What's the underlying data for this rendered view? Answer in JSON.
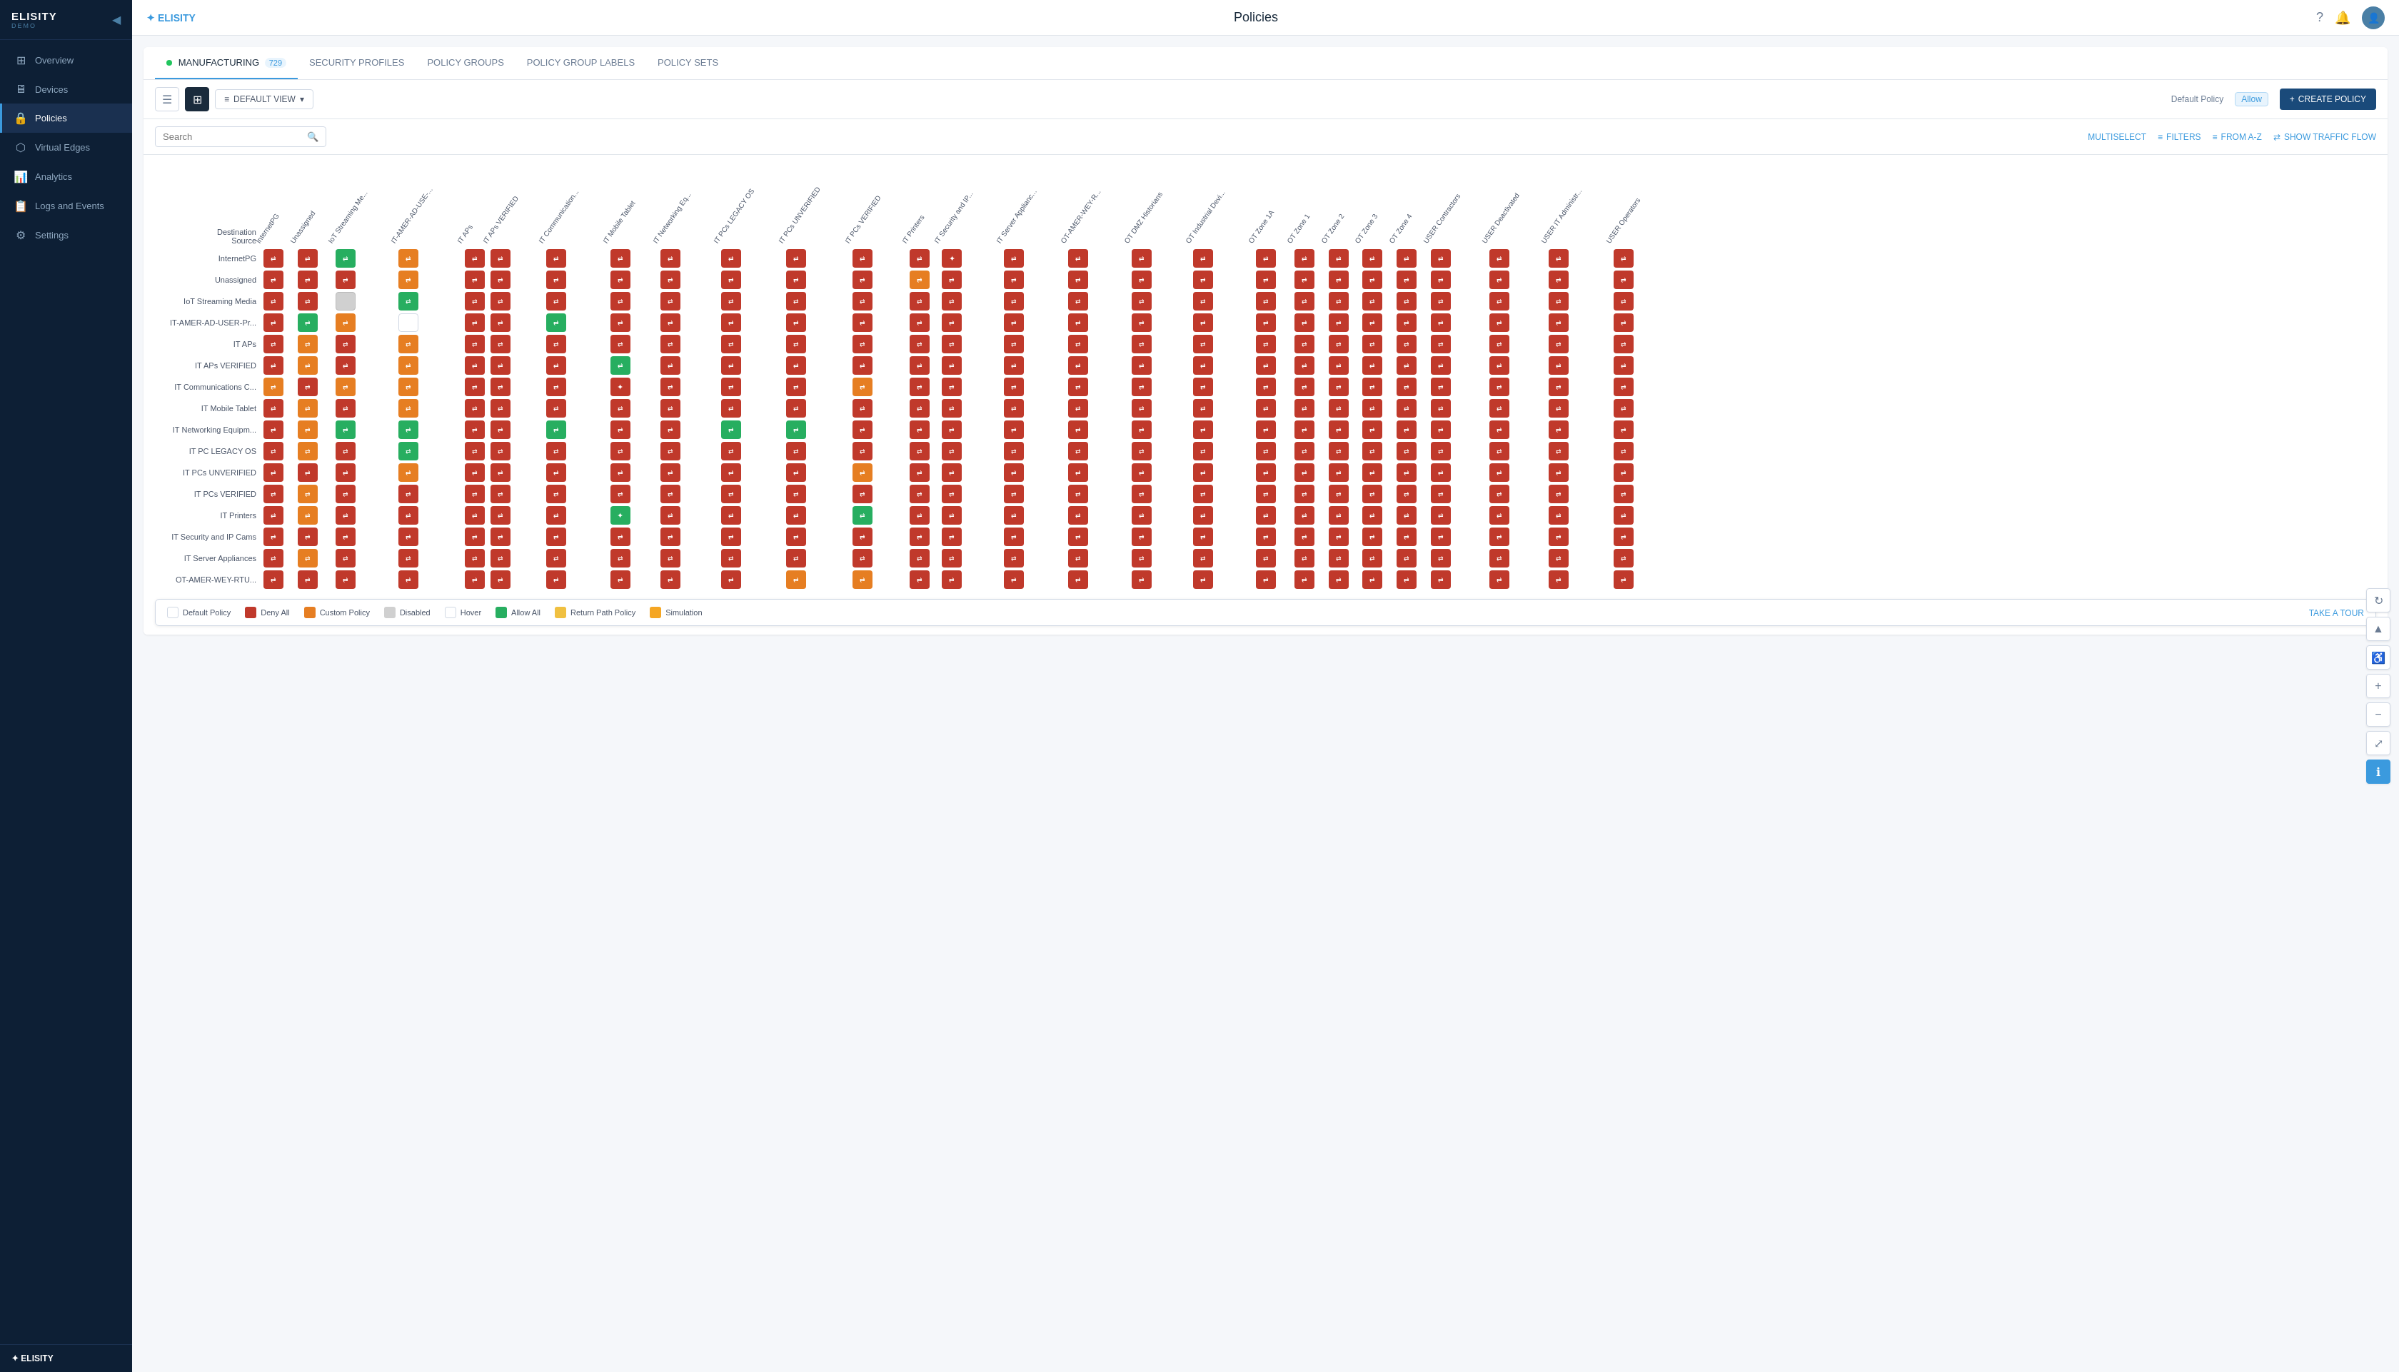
{
  "sidebar": {
    "logo": "ELISITY",
    "logo_sub": "DEMO",
    "collapse_icon": "◀",
    "items": [
      {
        "id": "overview",
        "label": "Overview",
        "icon": "⊞",
        "active": false
      },
      {
        "id": "devices",
        "label": "Devices",
        "icon": "🖥",
        "active": false
      },
      {
        "id": "policies",
        "label": "Policies",
        "icon": "🔒",
        "active": true
      },
      {
        "id": "virtual-edges",
        "label": "Virtual Edges",
        "icon": "⬡",
        "active": false
      },
      {
        "id": "analytics",
        "label": "Analytics",
        "icon": "📊",
        "active": false
      },
      {
        "id": "logs-events",
        "label": "Logs and Events",
        "icon": "📋",
        "active": false
      },
      {
        "id": "settings",
        "label": "Settings",
        "icon": "⚙",
        "active": false
      }
    ],
    "bottom_logo": "ELISITY"
  },
  "header": {
    "title": "Policies",
    "help_icon": "?",
    "bell_icon": "🔔",
    "avatar_icon": "👤"
  },
  "tabs": [
    {
      "id": "manufacturing",
      "label": "MANUFACTURING",
      "count": "729",
      "active": true,
      "dot": true
    },
    {
      "id": "security-profiles",
      "label": "SECURITY PROFILES",
      "active": false
    },
    {
      "id": "policy-groups",
      "label": "POLICY GROUPS",
      "active": false
    },
    {
      "id": "policy-group-labels",
      "label": "POLICY GROUP LABELS",
      "active": false
    },
    {
      "id": "policy-sets",
      "label": "POLICY SETS",
      "active": false
    }
  ],
  "toolbar": {
    "list_view_label": "≡",
    "grid_view_label": "⊞",
    "default_view_label": "DEFAULT VIEW",
    "default_view_icon": "≡",
    "chevron_icon": "▾",
    "default_policy_label": "Default Policy",
    "allow_label": "Allow",
    "create_btn_label": "+ CREATE POLICY",
    "plus_icon": "+"
  },
  "search": {
    "placeholder": "Search",
    "search_icon": "🔍"
  },
  "filters": {
    "multiselect_label": "MULTISELECT",
    "filters_label": "FILTERS",
    "filters_icon": "≡",
    "from_az_label": "FROM A-Z",
    "az_icon": "≡",
    "traffic_flow_label": "SHOW TRAFFIC FLOW",
    "flow_icon": "⇄"
  },
  "matrix": {
    "destination_label": "Destination",
    "source_label": "Source",
    "col_headers": [
      "InternetPG",
      "Unassigned",
      "IoT Streaming Me...",
      "IT-AMER-AD-USE-...",
      "IT APs",
      "IT APs VERIFIED",
      "IT Communication...",
      "IT Mobile Tablet",
      "IT Networking Eq...",
      "IT PCs LEGACY OS",
      "IT PCs UNVERIFIED",
      "IT PCs VERIFIED",
      "IT Printers",
      "IT Security and IP...",
      "IT Server Applianc...",
      "OT-AMER-WEY-R...",
      "OT DMZ Historians",
      "OT Industrial Devi...",
      "OT Zone 1A",
      "OT Zone 1",
      "OT Zone 2",
      "OT Zone 3",
      "OT Zone 4",
      "USER Contractors",
      "USER Deactivated",
      "USER IT Administr...",
      "USER Operators"
    ],
    "row_headers": [
      "InternetPG",
      "Unassigned",
      "IoT Streaming Media",
      "IT-AMER-AD-USER-Pr...",
      "IT APs",
      "IT APs VERIFIED",
      "IT Communications C...",
      "IT Mobile Tablet",
      "IT Networking Equipm...",
      "IT PC LEGACY OS",
      "IT PCs UNVERIFIED",
      "IT PCs VERIFIED",
      "IT Printers",
      "IT Security and IP Cams",
      "IT Server Appliances",
      "OT-AMER-WEY-RTU..."
    ]
  },
  "legend": {
    "items": [
      {
        "id": "default-policy",
        "label": "Default Policy",
        "color": "outline"
      },
      {
        "id": "deny-all",
        "label": "Deny All",
        "color": "#c0392b"
      },
      {
        "id": "custom-policy",
        "label": "Custom Policy",
        "color": "#e67e22"
      },
      {
        "id": "disabled",
        "label": "Disabled",
        "color": "#d0d0d0"
      },
      {
        "id": "hover",
        "label": "Hover",
        "color": "outline"
      },
      {
        "id": "allow-all",
        "label": "Allow All",
        "color": "#27ae60"
      },
      {
        "id": "return-path",
        "label": "Return Path Policy",
        "color": "#f0c040"
      },
      {
        "id": "simulation",
        "label": "Simulation",
        "color": "#f5a623"
      }
    ],
    "take_tour_label": "TAKE A TOUR"
  },
  "right_actions": [
    {
      "id": "refresh",
      "icon": "↻"
    },
    {
      "id": "pin",
      "icon": "▲"
    },
    {
      "id": "accessibility",
      "icon": "♿"
    },
    {
      "id": "zoom-in",
      "icon": "+"
    },
    {
      "id": "zoom-out",
      "icon": "−"
    },
    {
      "id": "fullscreen",
      "icon": "⤢"
    },
    {
      "id": "info",
      "icon": "ℹ"
    }
  ]
}
